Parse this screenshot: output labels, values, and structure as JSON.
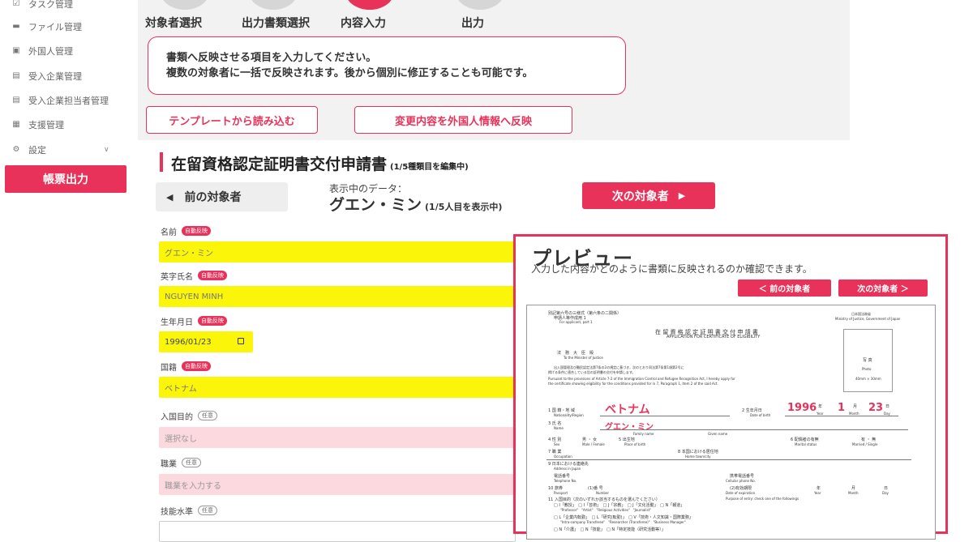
{
  "sidebar": {
    "items": [
      {
        "label": "タスク管理",
        "icon": "checkbox-icon"
      },
      {
        "label": "ファイル管理",
        "icon": "folder-icon"
      },
      {
        "label": "外国人管理",
        "icon": "id-card-icon"
      },
      {
        "label": "受入企業管理",
        "icon": "building-icon"
      },
      {
        "label": "受入企業担当者管理",
        "icon": "building-icon"
      },
      {
        "label": "支援管理",
        "icon": "clipboard-icon"
      },
      {
        "label": "設定",
        "icon": "gear-icon"
      }
    ],
    "active_label": "帳票出力"
  },
  "steps": [
    {
      "label": "対象者選択"
    },
    {
      "label": "出力書類選択"
    },
    {
      "label": "内容入力"
    },
    {
      "label": "出力"
    }
  ],
  "info": {
    "line1": "書類へ反映させる項目を入力してください。",
    "line2": "複数の対象者に一括で反映されます。後から個別に修正することも可能です。"
  },
  "actions": {
    "template_button": "テンプレートから読み込む",
    "apply_button": "変更内容を外国人情報へ反映"
  },
  "document": {
    "title": "在留資格認定証明書交付申請書",
    "subtitle": "(1/5種類目を編集中)",
    "prev_button": "前の対象者",
    "next_button": "次の対象者",
    "showing_label": "表示中のデータ：",
    "showing_name": "グエン・ミン",
    "showing_count": "(1/5人目を表示中)"
  },
  "fields": [
    {
      "label": "名前",
      "badge": "自動反映",
      "value": "グエン・ミン"
    },
    {
      "label": "英字氏名",
      "badge": "自動反映",
      "value": "NGUYEN MINH"
    },
    {
      "label": "生年月日",
      "badge": "自動反映",
      "value": "1996/01/23"
    },
    {
      "label": "国籍",
      "badge": "自動反映",
      "value": "ベトナム"
    },
    {
      "label": "入国目的",
      "badge": "任意",
      "value": "選択なし"
    },
    {
      "label": "職業",
      "badge": "任意",
      "placeholder": "職業を入力する"
    },
    {
      "label": "技能水準",
      "badge": "任意",
      "value": ""
    }
  ],
  "preview": {
    "title": "プレビュー",
    "subtitle": "入力した内容がどのように書類に反映されるのか確認できます。",
    "prev_button": "＜ 前の対象者",
    "next_button": "次の対象者 ＞",
    "doc": {
      "form_no": "別記第六号の三様式（第六条の二関係）",
      "applicant": "申請人等作成用 1",
      "applicant_en": "For applicant, part 1",
      "ministry_jp": "日本国法務省",
      "ministry_en": "Ministry of Justice, Government of Japan",
      "title_jp": "在 留 資 格 認 定 証 明 書 交 付 申 請 書",
      "title_en": "APPLICATION FOR CERTIFICATE OF ELIGIBILITY",
      "to_jp": "法　務　大　臣　殿",
      "to_en": "To the Minister of Justice",
      "body_jp1": "出入国管理及び難民認定法第7条の2の規定に基づき，次のとおり同法第7条第1項第2号に",
      "body_jp2": "掲げる条件に適合している旨の証明書の交付を申請します。",
      "body_en1": "Pursuant to the provisions of Article 7-2 of the Immigration Control and Refugee Recognition Act, I hereby apply for",
      "body_en2": "the certificate showing eligibility for the conditions provided for in 7, Paragraph 1, Item 2 of the said Act.",
      "photo_jp": "写 真",
      "photo_en": "Photo",
      "photo_size": "40mm × 30mm",
      "nationality_label": "1 国 籍・地 域",
      "nationality_label_en": "Nationality/Region",
      "nationality_value": "ベトナム",
      "dob_label": "2 生年月日",
      "dob_label_en": "Date of birth",
      "dob_year": "1996",
      "dob_month": "1",
      "dob_day": "23",
      "year_unit": "年",
      "month_unit": "月",
      "day_unit": "日",
      "year_en": "Year",
      "month_en": "Month",
      "day_en": "Day",
      "name_label": "3 氏 名",
      "name_label_en": "Name",
      "name_value": "グエン・ミン",
      "family_name_en": "Family name",
      "given_name_en": "Given name",
      "sex_label": "4 性 別",
      "sex_options": "男 ・ 女",
      "sex_en": "Sex",
      "sex_options_en": "Male / Female",
      "pob_label": "5 出生地",
      "pob_en": "Place of birth",
      "marital_label": "6 配偶者の有無",
      "marital_en": "Marital status",
      "marital_options": "有 ・ 無",
      "marital_options_en": "Married / Single",
      "occupation_label": "7 職 業",
      "occupation_en": "Occupation",
      "hometown_label": "8 本国における居住地",
      "hometown_en": "Home town/city",
      "address_label": "9 日本における連絡先",
      "address_en": "Address in Japan",
      "phone_label": "電話番号",
      "phone_en": "Telephone No.",
      "cell_label": "携帯電話番号",
      "cell_en": "Cellular phone No.",
      "passport_label": "10 旅券",
      "passport_no": "(1)番 号",
      "passport_en": "Passport",
      "number_en": "Number",
      "expiry_label": "(2)有効期限",
      "expiry_en": "Date of expiration",
      "purpose_label": "11 入国目的（次のいずれか該当するものを選んでください）",
      "purpose_en": "Purpose of entry: check one of the followings",
      "purpose_row1": "□ I「教授」　□ I「芸術」　□ J「宗教」　□ J「文化活動」　□ N「報道」",
      "purpose_row1_en": "\"Professor\"　\"Artist\"　\"Religious Activities\"　\"Journalist\"",
      "purpose_row2": "□ L「企業内転勤」　□ L「研究(転勤)」　□ V「技術・人文知識・国際業務」",
      "purpose_row2_en": "\"Intra-company Transferee\"　\"Researcher (Transferee)\"　\"Business Manager\"",
      "purpose_row3": "□ N「介護」　□ N「技能」　□ N「特定技能（研究活動等）」"
    }
  },
  "colors": {
    "accent": "#e8325a",
    "highlight": "#fbf50a",
    "optional_bg": "#fbd9de"
  }
}
